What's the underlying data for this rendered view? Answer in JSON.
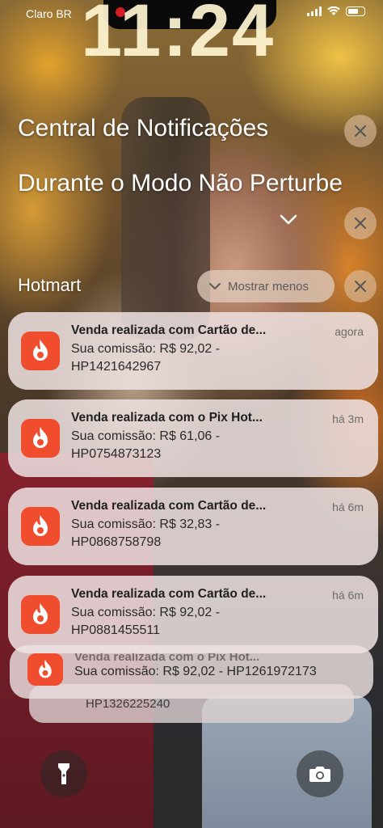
{
  "status_bar": {
    "carrier": "Claro BR",
    "time": "11:24"
  },
  "notification_center": {
    "title": "Central de Notificações",
    "dnd_title": "Durante o Modo Não Perturbe",
    "app_group": {
      "name": "Hotmart",
      "show_less_label": "Mostrar menos"
    },
    "notifications": [
      {
        "title": "Venda realizada com Cartão de...",
        "time": "agora",
        "body": "Sua comissão: R$ 92,02 - HP1421642967"
      },
      {
        "title": "Venda realizada com o Pix Hot...",
        "time": "há 3m",
        "body": "Sua comissão: R$ 61,06 - HP0754873123"
      },
      {
        "title": "Venda realizada com Cartão de...",
        "time": "há 6m",
        "body": "Sua comissão: R$ 32,83 - HP0868758798"
      },
      {
        "title": "Venda realizada com Cartão de...",
        "time": "há 6m",
        "body": "Sua comissão: R$ 92,02 - HP0881455511"
      }
    ],
    "stacked": [
      {
        "title": "Venda realizada com o Pix Hot...",
        "body": "Sua comissão: R$ 92,02 - HP1261972173"
      },
      {
        "body": "HP1326225240"
      }
    ]
  },
  "icons": {
    "app": "hotmart-flame-icon",
    "flashlight": "flashlight-icon",
    "camera": "camera-icon",
    "clear": "close-icon",
    "expand": "chevron-down-icon"
  },
  "colors": {
    "hotmart_brand": "#ef4d2e",
    "recording_dot": "#d61d26"
  }
}
